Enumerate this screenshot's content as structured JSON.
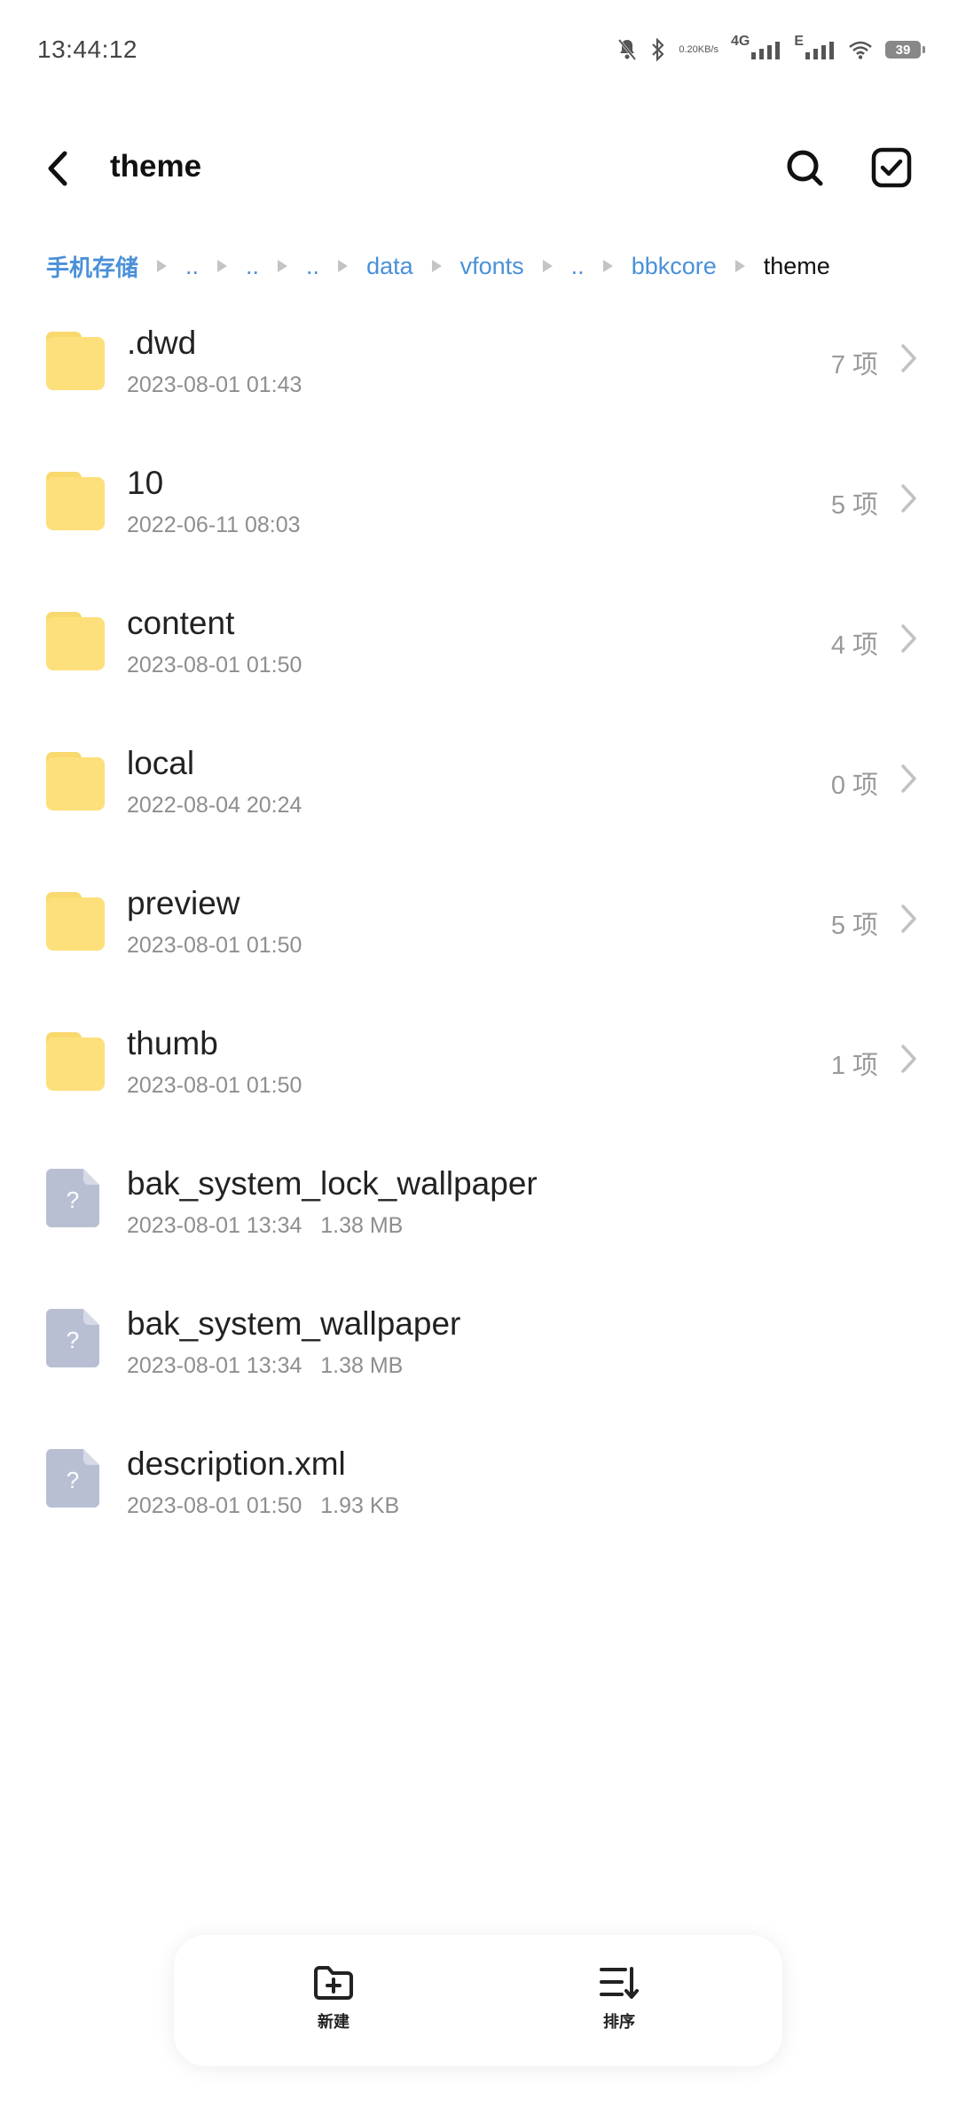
{
  "status_bar": {
    "time": "13:44:12",
    "net_speed_value": "0.20",
    "net_speed_unit": "KB/s",
    "sim1_label": "4G",
    "sim2_label": "E",
    "battery": "39"
  },
  "header": {
    "title": "theme"
  },
  "breadcrumb": {
    "items": [
      "手机存储",
      "..",
      "..",
      "..",
      "data",
      "vfonts",
      "..",
      "bbkcore"
    ],
    "current": "theme"
  },
  "files": [
    {
      "type": "folder",
      "name": ".dwd",
      "date": "2023-08-01 01:43",
      "count": "7 项"
    },
    {
      "type": "folder",
      "name": "10",
      "date": "2022-06-11 08:03",
      "count": "5 项"
    },
    {
      "type": "folder",
      "name": "content",
      "date": "2023-08-01 01:50",
      "count": "4 项"
    },
    {
      "type": "folder",
      "name": "local",
      "date": "2022-08-04 20:24",
      "count": "0 项"
    },
    {
      "type": "folder",
      "name": "preview",
      "date": "2023-08-01 01:50",
      "count": "5 项"
    },
    {
      "type": "folder",
      "name": "thumb",
      "date": "2023-08-01 01:50",
      "count": "1 项"
    },
    {
      "type": "file",
      "name": "bak_system_lock_wallpaper",
      "date": "2023-08-01 13:34",
      "size": "1.38 MB"
    },
    {
      "type": "file",
      "name": "bak_system_wallpaper",
      "date": "2023-08-01 13:34",
      "size": "1.38 MB"
    },
    {
      "type": "file",
      "name": "description.xml",
      "date": "2023-08-01 01:50",
      "size": "1.93 KB"
    }
  ],
  "bottom_bar": {
    "new_label": "新建",
    "sort_label": "排序"
  },
  "icons": {
    "back": "chevron-left-icon",
    "search": "search-icon",
    "select": "checkbox-icon",
    "folder": "folder-icon",
    "unknown_file": "unknown-file-icon",
    "new_folder": "new-folder-icon",
    "sort": "sort-icon"
  },
  "colors": {
    "accent": "#4a90d9",
    "folder": "#fde07b",
    "unknown_file": "#b9bfd3"
  }
}
